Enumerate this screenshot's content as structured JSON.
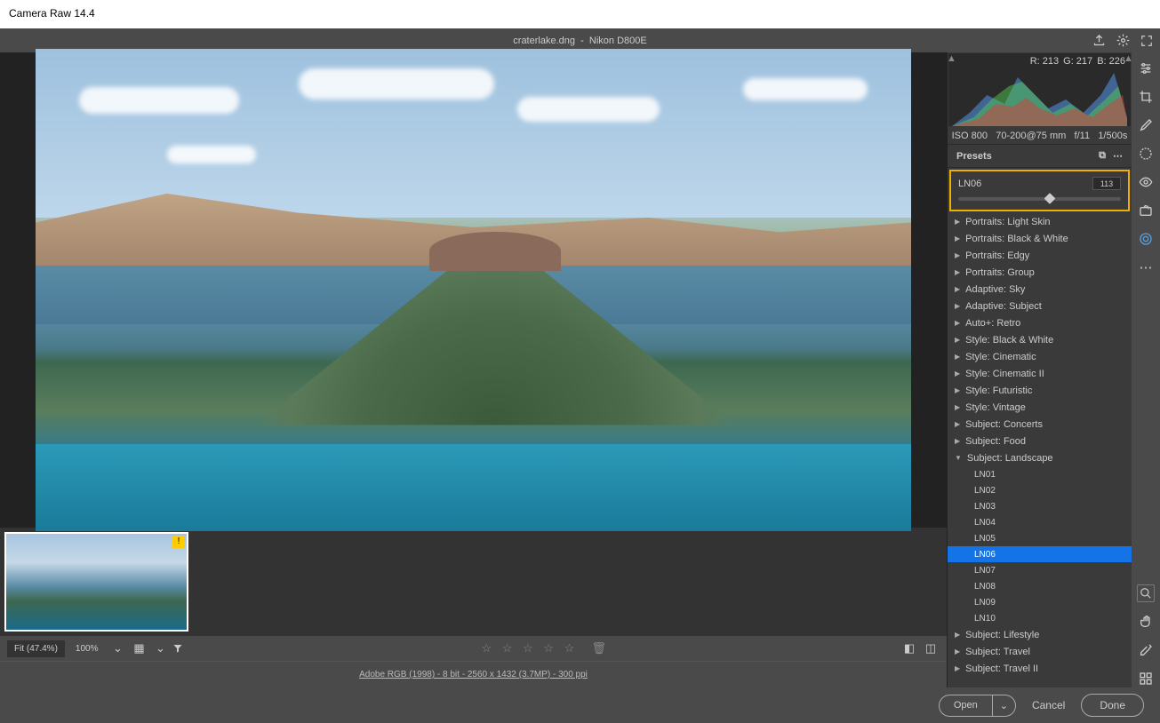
{
  "app_title": "Camera Raw 14.4",
  "header": {
    "filename": "craterlake.dng",
    "camera": "Nikon D800E"
  },
  "rgb": {
    "r": "R: 213",
    "g": "G: 217",
    "b": "B: 226"
  },
  "meta": {
    "iso": "ISO 800",
    "lens": "70-200@75 mm",
    "aperture": "f/11",
    "shutter": "1/500s"
  },
  "panel_title": "Presets",
  "amount": {
    "label": "LN06",
    "value": "113",
    "percent": 56.5
  },
  "preset_groups": [
    {
      "label": "Portraits: Light Skin",
      "expanded": false
    },
    {
      "label": "Portraits: Black & White",
      "expanded": false
    },
    {
      "label": "Portraits: Edgy",
      "expanded": false
    },
    {
      "label": "Portraits: Group",
      "expanded": false
    },
    {
      "label": "Adaptive: Sky",
      "expanded": false
    },
    {
      "label": "Adaptive: Subject",
      "expanded": false
    },
    {
      "label": "Auto+: Retro",
      "expanded": false
    },
    {
      "label": "Style: Black & White",
      "expanded": false
    },
    {
      "label": "Style: Cinematic",
      "expanded": false
    },
    {
      "label": "Style: Cinematic II",
      "expanded": false
    },
    {
      "label": "Style: Futuristic",
      "expanded": false
    },
    {
      "label": "Style: Vintage",
      "expanded": false
    },
    {
      "label": "Subject: Concerts",
      "expanded": false
    },
    {
      "label": "Subject: Food",
      "expanded": false
    },
    {
      "label": "Subject: Landscape",
      "expanded": true,
      "items": [
        "LN01",
        "LN02",
        "LN03",
        "LN04",
        "LN05",
        "LN06",
        "LN07",
        "LN08",
        "LN09",
        "LN10"
      ],
      "selected": "LN06"
    },
    {
      "label": "Subject: Lifestyle",
      "expanded": false
    },
    {
      "label": "Subject: Travel",
      "expanded": false
    },
    {
      "label": "Subject: Travel II",
      "expanded": false
    }
  ],
  "bottom": {
    "fit": "Fit (47.4%)",
    "zoom": "100%",
    "info": "Adobe RGB (1998) - 8 bit - 2560 x 1432 (3.7MP) - 300 ppi"
  },
  "footer": {
    "open": "Open",
    "cancel": "Cancel",
    "done": "Done"
  },
  "thumb_warn": "!"
}
